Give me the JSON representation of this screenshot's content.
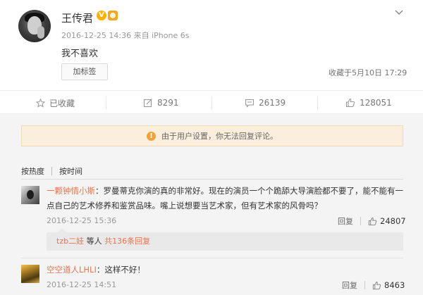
{
  "post": {
    "username": "王传君",
    "verified_mark": "V",
    "meta": "2016-12-25 14:36 来自 iPhone 6s",
    "text": "我不喜欢",
    "tag_button": "加标签",
    "fav_time": "收藏于5月10日 17:29"
  },
  "actions": {
    "favorited": "已收藏",
    "reposts": "8291",
    "comments": "26139",
    "likes": "128051"
  },
  "notice": {
    "icon": "!",
    "text": "由于用户设置，你无法回复评论。"
  },
  "sort": {
    "by_hot": "按热度",
    "by_time": "按时间"
  },
  "comments": [
    {
      "name": "一颗钟情小斯",
      "text": "：罗曼蒂克你演的真的非常好。现在的演员一个个跪舔大导演脸都不要了，能不能有一点自己的艺术修养和鉴赏品味。嘴上说想要当艺术家，但有艺术家的风骨吗？",
      "time": "2016-12-25 15:36",
      "reply_label": "回复",
      "likes": "24807",
      "replies": {
        "name": "tzb二娃",
        "middle": " 等人 ",
        "count": "共136条回复"
      }
    },
    {
      "name": "空空道人LHLI",
      "text": "：这样不好！",
      "time": "2016-12-25 14:51",
      "reply_label": "回复",
      "likes": "8463"
    }
  ],
  "colors": {
    "accent": "#eb7350",
    "notice_bg": "#fbeedd",
    "vip_gold": "#f5a623"
  }
}
